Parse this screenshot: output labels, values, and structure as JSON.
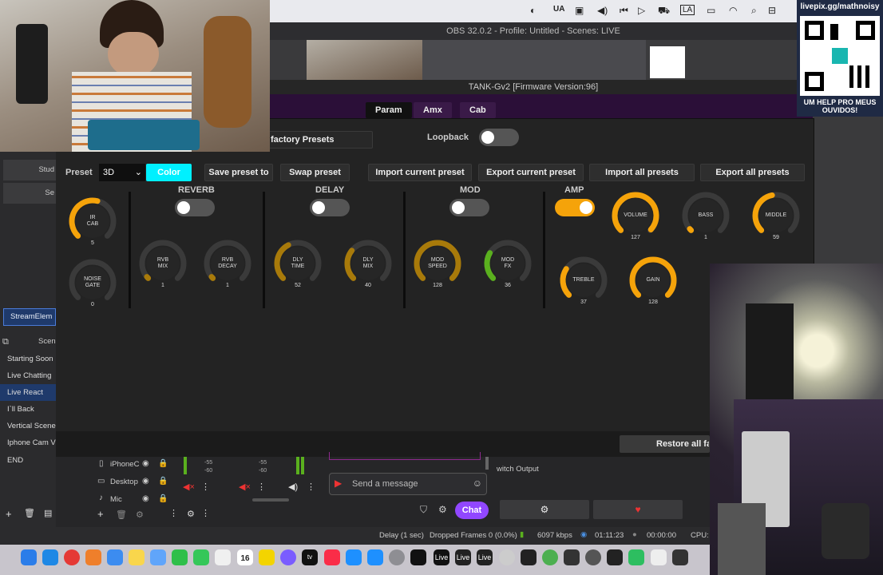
{
  "menubar": {
    "input_label": "UA",
    "lang_label": "LA"
  },
  "obs": {
    "title": "OBS 32.0.2 - Profile: Untitled - Scenes: LIVE"
  },
  "tank": {
    "title": "TANK-Gv2 [Firmware Version:96]",
    "tabs": [
      "Param",
      "Amx",
      "Cab"
    ],
    "factory_presets": "factory Presets",
    "loopback_label": "Loopback",
    "preset_label": "Preset",
    "preset_value": "3D",
    "color_button": "Color",
    "buttons": {
      "save_preset_to": "Save preset to",
      "swap_preset": "Swap preset",
      "import_current": "Import current preset",
      "export_current": "Export current preset",
      "import_all": "Import all presets",
      "export_all": "Export all presets",
      "restore": "Restore all fac"
    },
    "sections": {
      "reverb": "REVERB",
      "delay": "DELAY",
      "mod": "MOD",
      "amp": "AMP"
    },
    "knobs": [
      {
        "l1": "IR",
        "l2": "CAB",
        "value": "5",
        "level": 0.55
      },
      {
        "l1": "NOISE",
        "l2": "GATE",
        "value": "0",
        "level": 0.0
      },
      {
        "l1": "RVB",
        "l2": "MIX",
        "value": "1",
        "level": 0.02
      },
      {
        "l1": "RVB",
        "l2": "DECAY",
        "value": "1",
        "level": 0.02
      },
      {
        "l1": "DLY",
        "l2": "TIME",
        "value": "52",
        "level": 0.4
      },
      {
        "l1": "DLY",
        "l2": "MIX",
        "value": "40",
        "level": 0.31
      },
      {
        "l1": "MOD",
        "l2": "SPEED",
        "value": "128",
        "level": 1.0
      },
      {
        "l1": "MOD",
        "l2": "FX",
        "value": "36",
        "level": 0.28
      },
      {
        "l1": "VOLUME",
        "l2": "",
        "value": "127",
        "level": 0.99
      },
      {
        "l1": "BASS",
        "l2": "",
        "value": "1",
        "level": 0.02
      },
      {
        "l1": "MIDDLE",
        "l2": "",
        "value": "59",
        "level": 0.46
      },
      {
        "l1": "TREBLE",
        "l2": "",
        "value": "37",
        "level": 0.29
      },
      {
        "l1": "GAIN",
        "l2": "",
        "value": "128",
        "level": 1.0
      }
    ]
  },
  "left_panel": {
    "studio_btn": "Stud",
    "settings_btn": "Se",
    "stream_elements": "StreamElem",
    "scenes_header": "Scen",
    "scenes": [
      "Starting Soon",
      "Live Chatting",
      "Live React",
      "I`ll Back",
      "Vertical Scene",
      "Iphone Cam V",
      "END"
    ]
  },
  "audio": {
    "sources": [
      "iPhoneC",
      "Desktop",
      "Mic"
    ],
    "db_labels": [
      "-55",
      "-60",
      "-55",
      "-60"
    ]
  },
  "chat": {
    "placeholder": "Send a message",
    "chat_button": "Chat"
  },
  "switch_output": "witch Output",
  "status": {
    "delay": "Delay (1 sec)",
    "dropped": "Dropped Frames 0 (0.0%)",
    "kbps": "6097 kbps",
    "time1": "01:11:23",
    "time2": "00:00:00",
    "cpu": "CPU: 3"
  },
  "overlay": {
    "url": "livepix.gg/mathnoisy",
    "help_text": "UM HELP PRO MEUS OUVIDOS!"
  },
  "dock": {
    "calendar_day": "16",
    "live_labels": [
      "Live",
      "Live",
      "Live"
    ],
    "tv_label": "tv"
  },
  "colors": {
    "accent_orange": "#f5a30a",
    "dim_orange": "#a87a0a",
    "green": "#5ab01e",
    "cyan": "#00f0ff",
    "purple_chat": "#9147ff"
  }
}
